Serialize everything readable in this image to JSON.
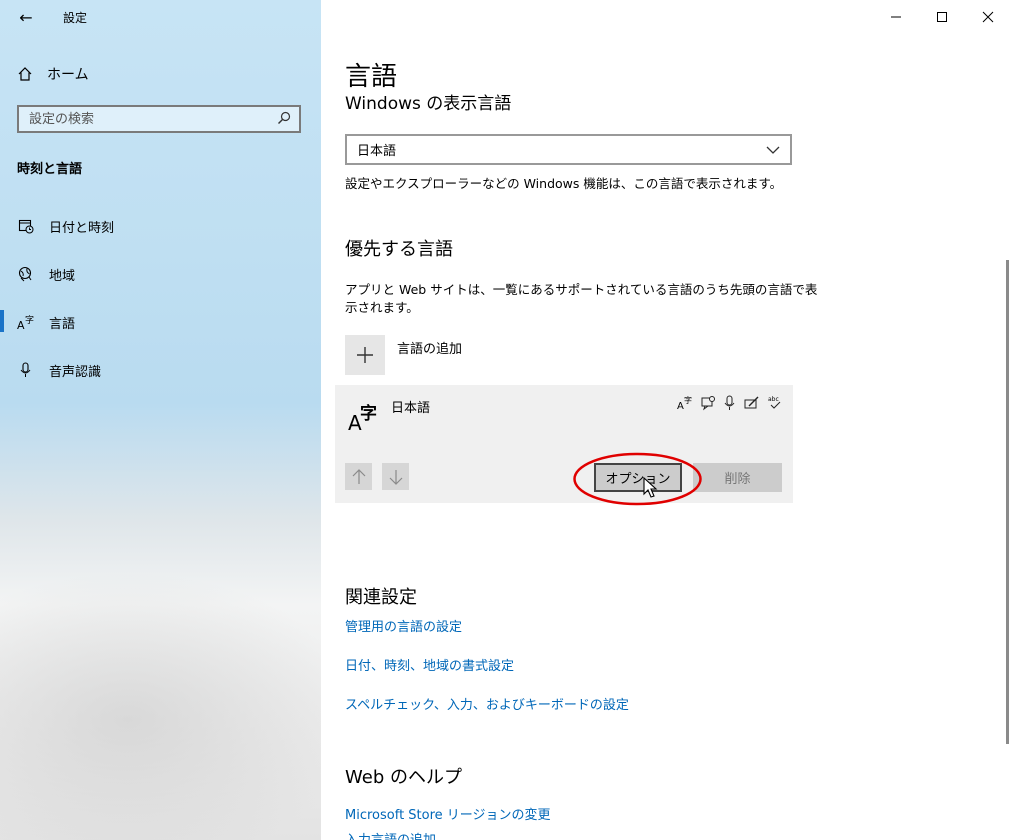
{
  "window": {
    "title": "設定",
    "back_glyph": "←",
    "minimize_glyph": "—",
    "maximize_glyph": "☐",
    "close_glyph": "✕"
  },
  "sidebar": {
    "home_label": "ホーム",
    "search_placeholder": "設定の検索",
    "section_title": "時刻と言語",
    "items": [
      {
        "label": "日付と時刻",
        "icon": "calendar-clock-icon"
      },
      {
        "label": "地域",
        "icon": "globe-icon"
      },
      {
        "label": "言語",
        "icon": "language-icon"
      },
      {
        "label": "音声認識",
        "icon": "microphone-icon"
      }
    ],
    "active_index": 2
  },
  "main": {
    "title": "言語",
    "display_language_heading": "Windows の表示言語",
    "display_language_value": "日本語",
    "display_language_desc": "設定やエクスプローラーなどの Windows 機能は、この言語で表示されます。",
    "preferred_heading": "優先する言語",
    "preferred_desc_line1": "アプリと Web サイトは、一覧にあるサポートされている言語のうち先頭の言語で表",
    "preferred_desc_line2": "示されます。",
    "add_language_label": "言語の追加",
    "language_card": {
      "name": "日本語",
      "glyph_a": "A",
      "glyph_ji": "字",
      "features": [
        "display-language-icon",
        "speech-icon",
        "microphone-icon",
        "handwriting-icon",
        "spellcheck-icon"
      ],
      "options_label": "オプション",
      "remove_label": "削除"
    },
    "related_heading": "関連設定",
    "related_links": [
      "管理用の言語の設定",
      "日付、時刻、地域の書式設定",
      "スペルチェック、入力、およびキーボードの設定"
    ],
    "help_heading": "Web のヘルプ",
    "help_links": [
      "Microsoft Store リージョンの変更",
      "入力言語の追加"
    ]
  },
  "colors": {
    "accent": "#1a73c8",
    "link": "#0067b8",
    "highlight_ellipse": "#e00000"
  }
}
